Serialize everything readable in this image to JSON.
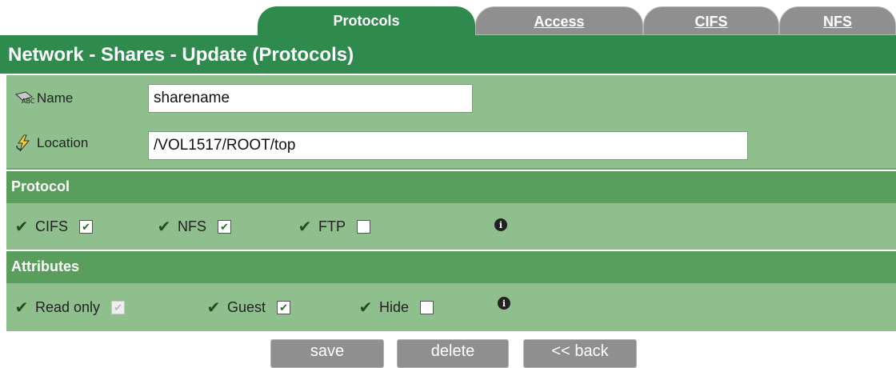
{
  "tabs": [
    {
      "label": "Protocols",
      "active": true
    },
    {
      "label": "Access",
      "active": false
    },
    {
      "label": "CIFS",
      "active": false
    },
    {
      "label": "NFS",
      "active": false
    }
  ],
  "title": "Network - Shares - Update (Protocols)",
  "fields": {
    "name": {
      "label": "Name",
      "value": "sharename",
      "icon": "name-tag-icon"
    },
    "location": {
      "label": "Location",
      "value": "/VOL1517/ROOT/top",
      "icon": "lightning-folder-icon"
    }
  },
  "protocol_section": {
    "header": "Protocol",
    "options": [
      {
        "label": "CIFS",
        "checked": true
      },
      {
        "label": "NFS",
        "checked": true
      },
      {
        "label": "FTP",
        "checked": false
      }
    ]
  },
  "attributes_section": {
    "header": "Attributes",
    "options": [
      {
        "label": "Read only",
        "checked": true,
        "disabled": true
      },
      {
        "label": "Guest",
        "checked": true
      },
      {
        "label": "Hide",
        "checked": false
      }
    ]
  },
  "buttons": {
    "save": "save",
    "delete": "delete",
    "back": "<< back"
  },
  "colors": {
    "tab_active": "#2f8a4e",
    "title_bar": "#2f8a4e",
    "section_header": "#5a9e5e",
    "row_bg": "#8fbf8c",
    "tab_inactive": "#8f8f8f"
  }
}
